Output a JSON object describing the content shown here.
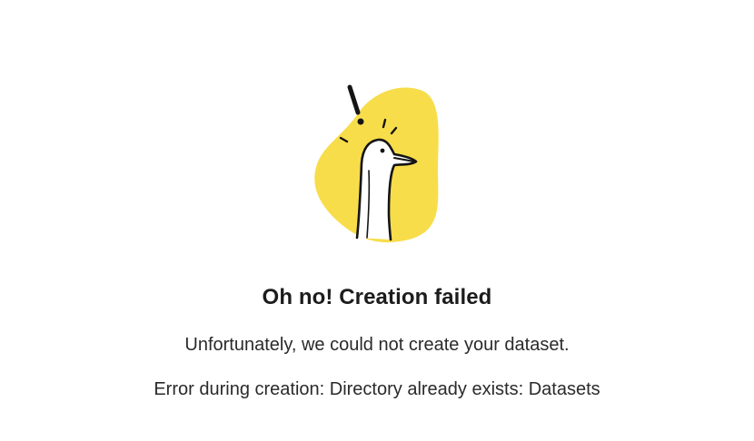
{
  "illustration": {
    "icon": "surprised-goose-icon",
    "blob_color": "#f8dd4a"
  },
  "error": {
    "title": "Oh no! Creation failed",
    "message": "Unfortunately, we could not create your dataset.",
    "detail": "Error during creation: Directory already exists: Datasets"
  }
}
